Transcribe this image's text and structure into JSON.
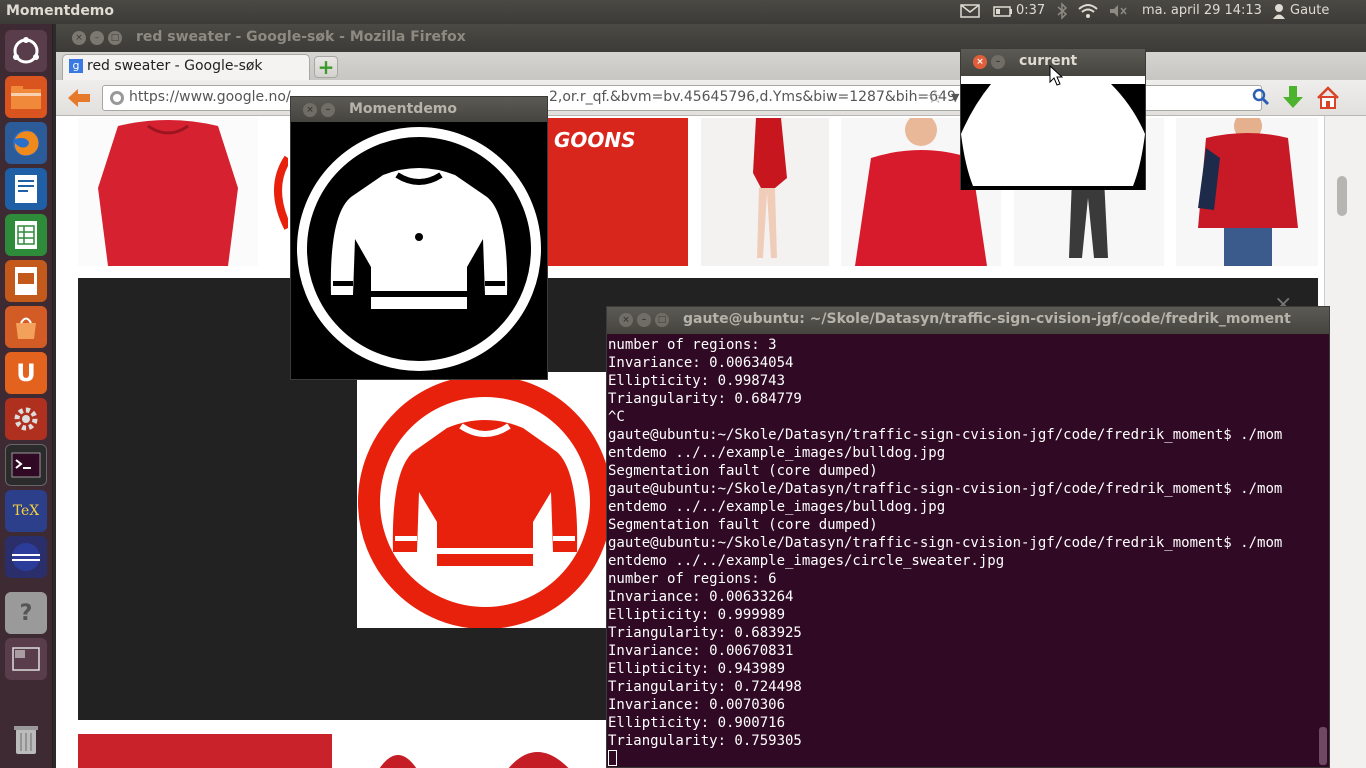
{
  "top_panel": {
    "app_name": "Momentdemo",
    "battery": "0:37",
    "datetime": "ma. april 29 14:13",
    "user": "Gaute",
    "icons": [
      "mail-icon",
      "battery-icon",
      "bluetooth-icon",
      "wifi-icon",
      "volume-icon",
      "user-icon"
    ]
  },
  "launcher": {
    "items": [
      "dash-icon",
      "files-icon",
      "firefox-icon",
      "writer-icon",
      "calc-icon",
      "impress-icon",
      "software-center-icon",
      "ubuntu-one-icon",
      "settings-icon",
      "terminal-icon",
      "texmaker-icon",
      "eclipse-icon",
      "help-icon",
      "workspace-icon",
      "trash-icon"
    ],
    "labels": {
      "ubuntu_one": "U",
      "texmaker": "TeX",
      "help": "?"
    }
  },
  "firefox": {
    "window_title": "red sweater - Google-søk - Mozilla Firefox",
    "tab_label": "red sweater - Google-søk",
    "tab_favicon": "g",
    "new_tab_symbol": "+",
    "url_visible_left": "https://www.google.no/",
    "url_visible_right": "2,or.r_qf.&bvm=bv.45645796,d.Yms&biw=1287&bih=649",
    "thumb_text": "GOONS"
  },
  "moment_window": {
    "title": "Momentdemo"
  },
  "current_window": {
    "title": "current"
  },
  "terminal": {
    "title": "gaute@ubuntu: ~/Skole/Datasyn/traffic-sign-cvision-jgf/code/fredrik_moment",
    "lines": [
      "number of regions: 3",
      "Invariance: 0.00634054",
      "Ellipticity: 0.998743",
      "Triangularity: 0.684779",
      "^C",
      "gaute@ubuntu:~/Skole/Datasyn/traffic-sign-cvision-jgf/code/fredrik_moment$ ./mom",
      "entdemo ../../example_images/bulldog.jpg",
      "Segmentation fault (core dumped)",
      "gaute@ubuntu:~/Skole/Datasyn/traffic-sign-cvision-jgf/code/fredrik_moment$ ./mom",
      "entdemo ../../example_images/bulldog.jpg",
      "Segmentation fault (core dumped)",
      "gaute@ubuntu:~/Skole/Datasyn/traffic-sign-cvision-jgf/code/fredrik_moment$ ./mom",
      "entdemo ../../example_images/circle_sweater.jpg",
      "number of regions: 6",
      "Invariance: 0.00633264",
      "Ellipticity: 0.999989",
      "Triangularity: 0.683925",
      "Invariance: 0.00670831",
      "Ellipticity: 0.943989",
      "Triangularity: 0.724498",
      "Invariance: 0.0070306",
      "Ellipticity: 0.900716",
      "Triangularity: 0.759305"
    ]
  },
  "colors": {
    "terminal_bg": "#300a24",
    "ubuntu_orange": "#e05f3a",
    "sweater_red": "#e8210d",
    "panel": "#3c3b37"
  }
}
